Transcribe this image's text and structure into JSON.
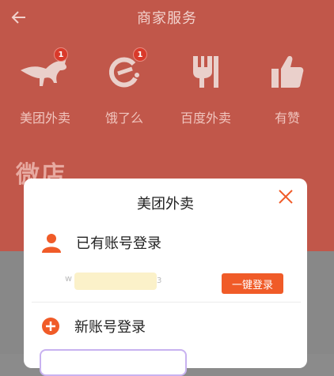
{
  "header": {
    "title": "商家服务"
  },
  "apps": [
    {
      "label": "美团外卖",
      "icon": "kangaroo-icon",
      "badge": "1"
    },
    {
      "label": "饿了么",
      "icon": "eleme-icon",
      "badge": "1"
    },
    {
      "label": "百度外卖",
      "icon": "fork-icon",
      "badge": ""
    },
    {
      "label": "有赞",
      "icon": "thumb-icon",
      "badge": ""
    }
  ],
  "section": {
    "title": "微店"
  },
  "modal": {
    "title": "美团外卖",
    "existing_login": "已有账号登录",
    "account_prefix": "w",
    "account_suffix": "3",
    "one_key_login": "一键登录",
    "new_login": "新账号登录"
  },
  "colors": {
    "header_bg": "#c1574a",
    "accent": "#f05b28",
    "overlay": "#888888"
  }
}
